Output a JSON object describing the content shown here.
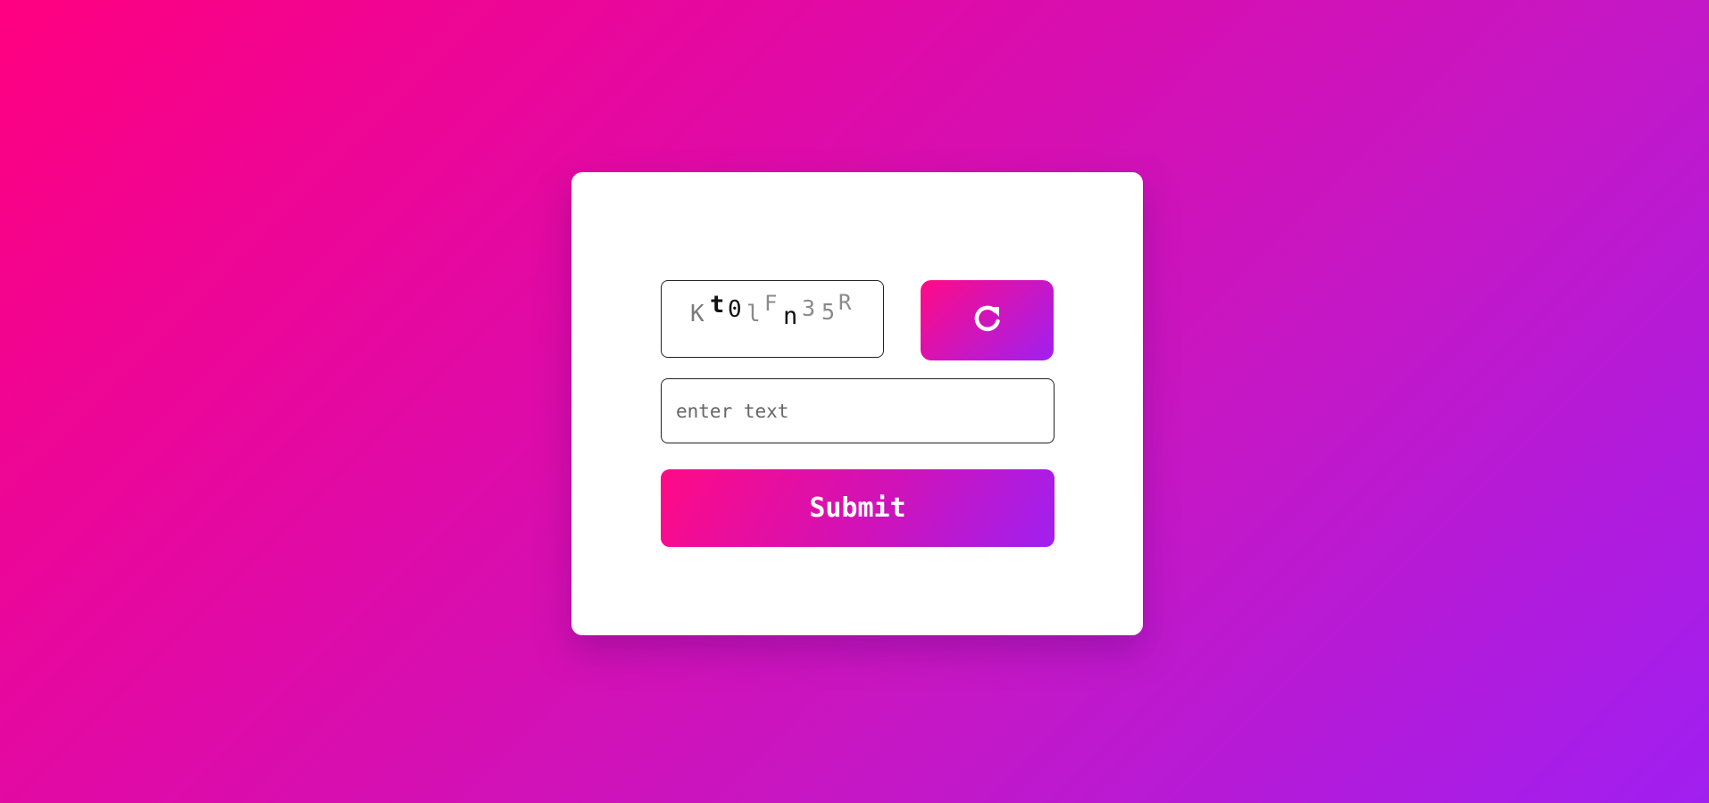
{
  "captcha": {
    "characters": [
      "K",
      "t",
      "0",
      "l",
      "F",
      "n",
      "3",
      "5",
      "R"
    ]
  },
  "refresh": {
    "icon": "refresh-icon"
  },
  "input": {
    "placeholder": "enter text",
    "value": ""
  },
  "submit": {
    "label": "Submit"
  },
  "colors": {
    "gradient_start": "#ff0080",
    "gradient_end": "#a020f0",
    "card_background": "#ffffff"
  }
}
